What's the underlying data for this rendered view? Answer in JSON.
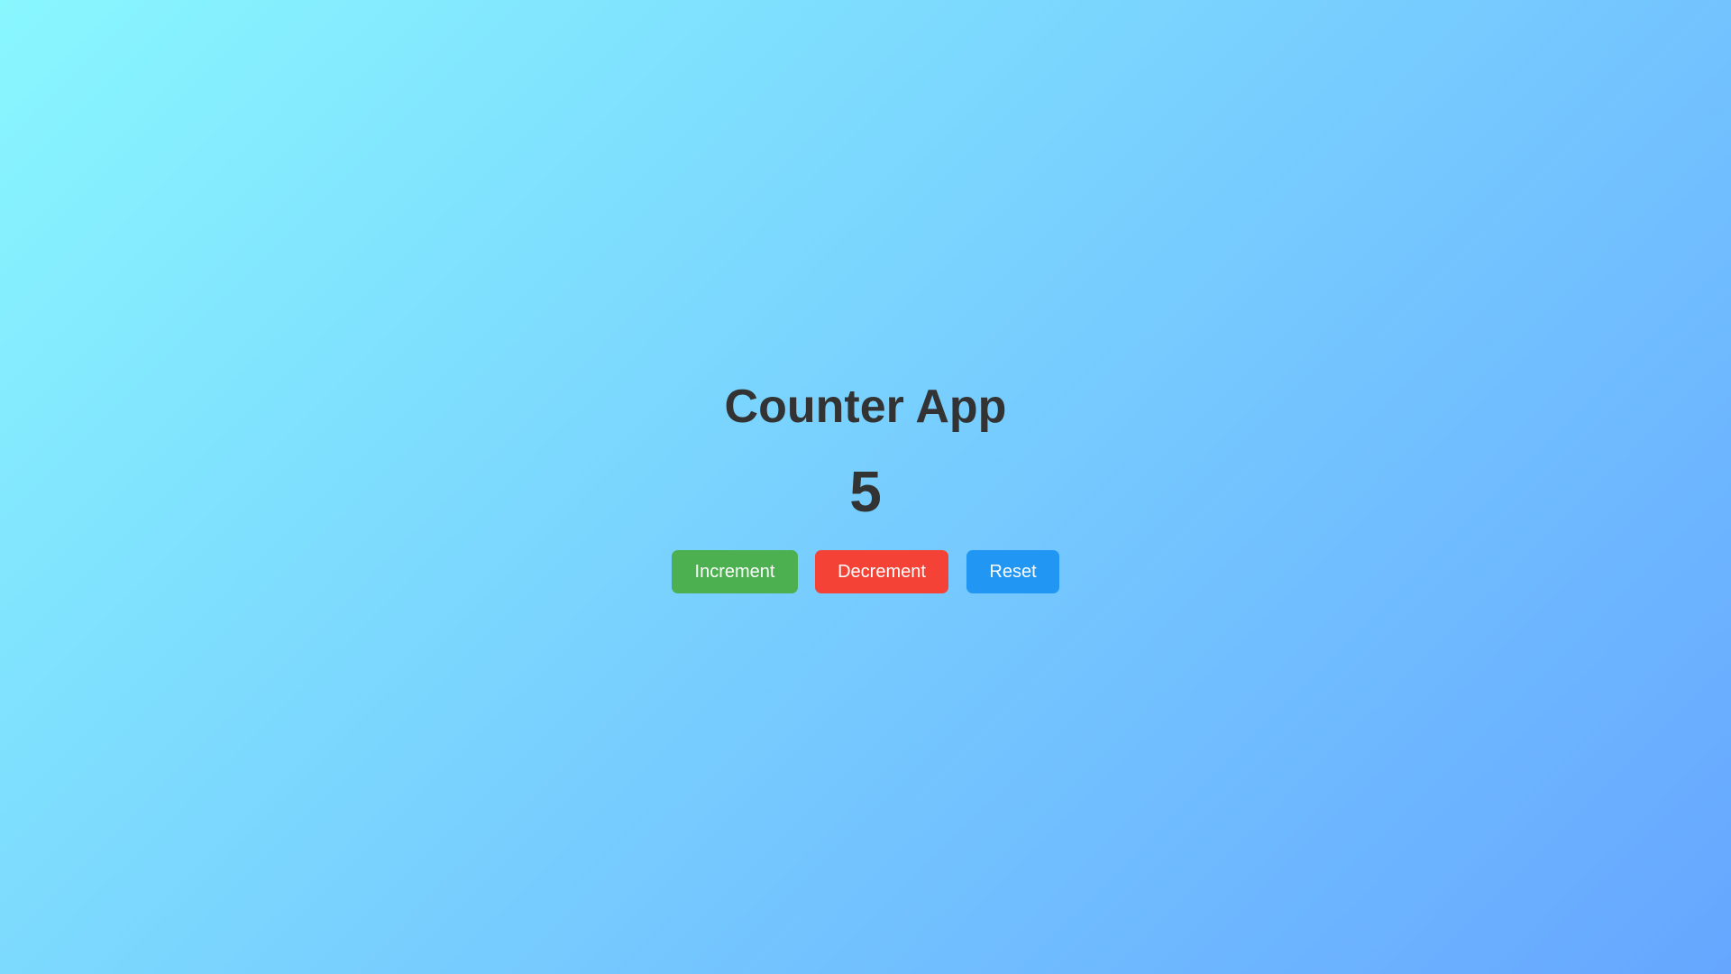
{
  "app": {
    "title": "Counter App",
    "count": "5"
  },
  "buttons": [
    {
      "label": "Increment",
      "color": "#4caf50"
    },
    {
      "label": "Decrement",
      "color": "#f44336"
    },
    {
      "label": "Reset",
      "color": "#2196f3"
    }
  ],
  "colors": {
    "background_start": "#89f7fe",
    "background_end": "#66a6ff",
    "text": "#333333"
  }
}
